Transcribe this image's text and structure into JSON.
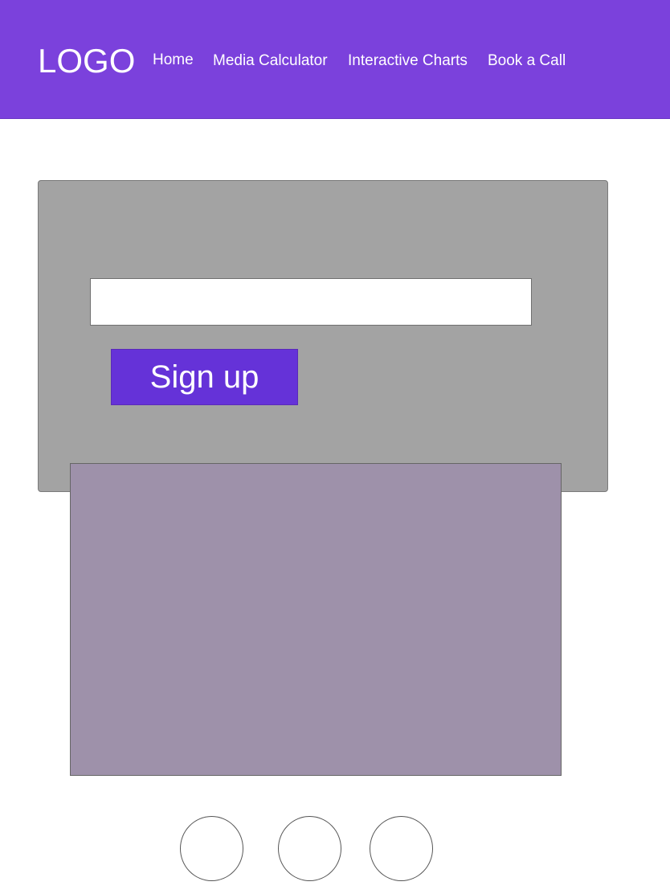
{
  "header": {
    "logo": "LOGO",
    "nav": {
      "home": "Home",
      "media_calculator": "Media Calculator",
      "interactive_charts": "Interactive Charts",
      "book_a_call": "Book a Call"
    }
  },
  "signup": {
    "input_value": "",
    "button_label": "Sign up"
  },
  "carousel": {
    "dot_count": 3
  },
  "colors": {
    "header_bg": "#7b41dc",
    "panel_bg": "#a3a3a3",
    "button_bg": "#6532d8",
    "media_bg": "#9e91aa"
  }
}
